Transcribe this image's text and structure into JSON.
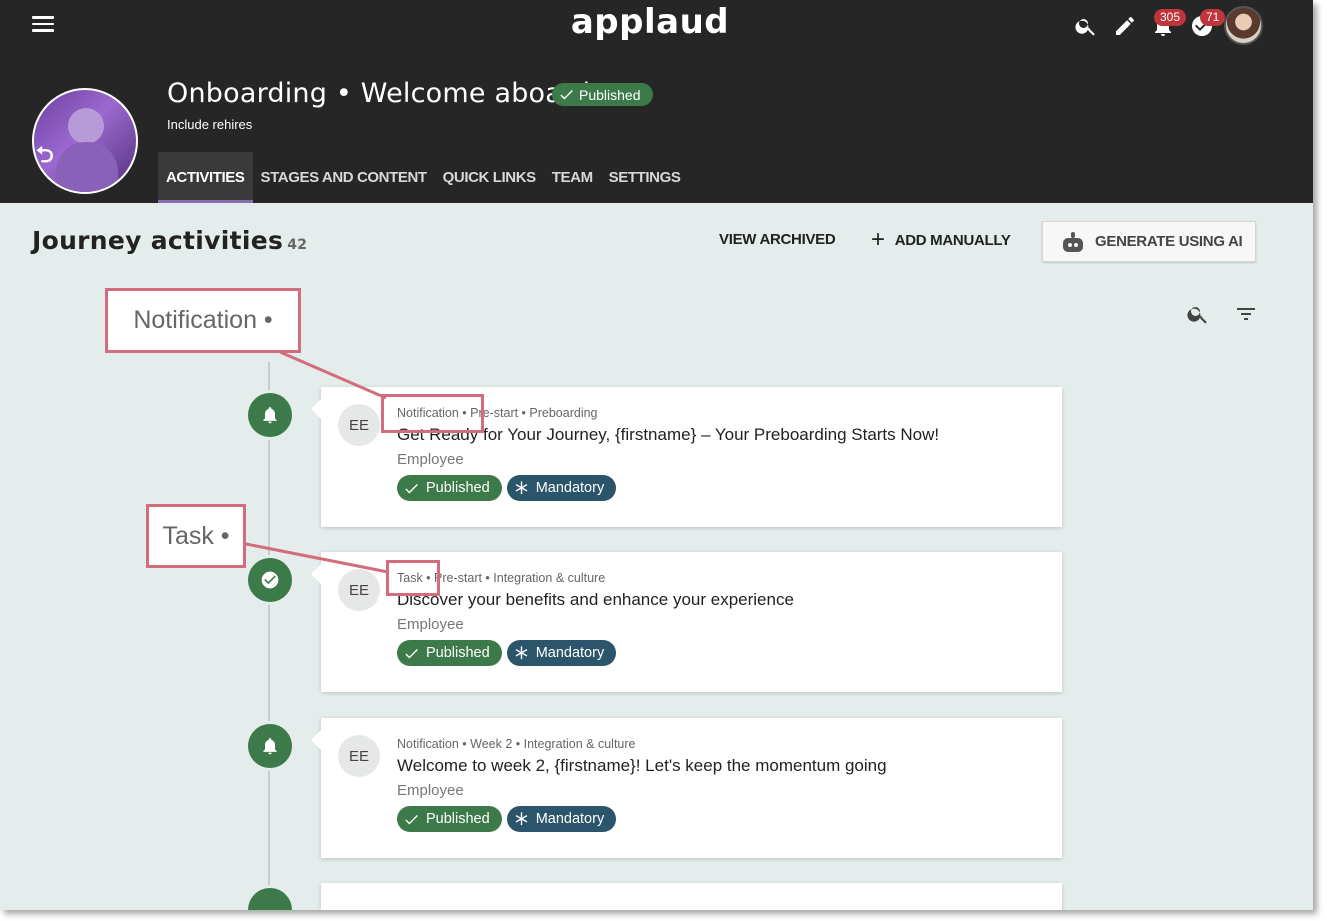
{
  "app": {
    "logo": "applaud"
  },
  "header": {
    "notifications_count": "305",
    "tasks_count": "71",
    "journey_title": "Onboarding • Welcome aboard",
    "status": "Published",
    "subtitle": "Include rehires",
    "tabs": [
      "ACTIVITIES",
      "STAGES AND CONTENT",
      "QUICK LINKS",
      "TEAM",
      "SETTINGS"
    ],
    "active_tab": "ACTIVITIES"
  },
  "section": {
    "title": "Journey activities",
    "count": "42",
    "view_archived": "VIEW ARCHIVED",
    "add_manually": "ADD MANUALLY",
    "generate_ai": "GENERATE USING AI"
  },
  "activities": [
    {
      "type_icon": "bell-icon",
      "initials": "EE",
      "meta": "Notification • Pre-start • Preboarding",
      "title": "Get Ready for Your Journey, {firstname} – Your Preboarding Starts Now!",
      "audience": "Employee",
      "tags": [
        "Published",
        "Mandatory"
      ]
    },
    {
      "type_icon": "check-circle-icon",
      "initials": "EE",
      "meta": "Task • Pre-start • Integration & culture",
      "title": "Discover your benefits and enhance your experience",
      "audience": "Employee",
      "tags": [
        "Published",
        "Mandatory"
      ]
    },
    {
      "type_icon": "bell-icon",
      "initials": "EE",
      "meta": "Notification • Week 2 • Integration & culture",
      "title": "Welcome to week 2, {firstname}! Let's keep the momentum going",
      "audience": "Employee",
      "tags": [
        "Published",
        "Mandatory"
      ]
    }
  ],
  "callouts": {
    "notification": "Notification •",
    "task": "Task •"
  },
  "colors": {
    "header_bg": "#262626",
    "page_bg": "#e4ecec",
    "published_green": "#3d7a4a",
    "mandatory_blue": "#2b556b",
    "badge_red": "#c0353c",
    "callout_pink": "#d16d7c"
  }
}
